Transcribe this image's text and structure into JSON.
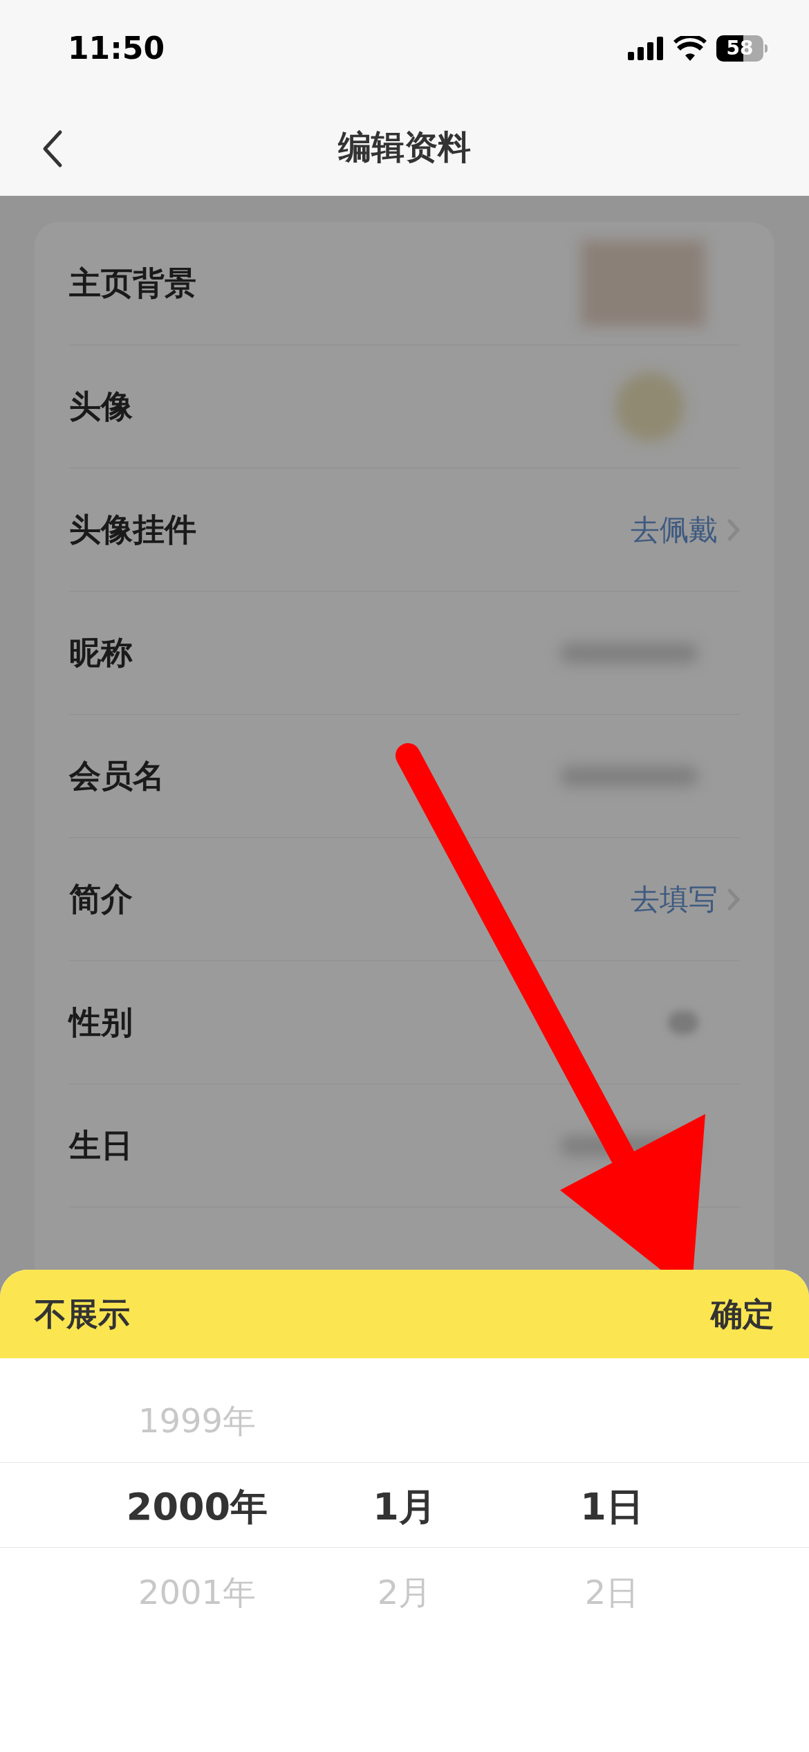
{
  "status_bar": {
    "time": "11:50",
    "battery": "58"
  },
  "nav": {
    "title": "编辑资料"
  },
  "rows": [
    {
      "label": "主页背景",
      "kind": "image"
    },
    {
      "label": "头像",
      "kind": "avatar"
    },
    {
      "label": "头像挂件",
      "kind": "link",
      "value": "去佩戴"
    },
    {
      "label": "昵称",
      "kind": "blurred"
    },
    {
      "label": "会员名",
      "kind": "blurred"
    },
    {
      "label": "简介",
      "kind": "link",
      "value": "去填写"
    },
    {
      "label": "性别",
      "kind": "dot"
    },
    {
      "label": "生日",
      "kind": "blurred"
    }
  ],
  "sheet": {
    "cancel": "不展示",
    "confirm": "确定",
    "columns": [
      {
        "items": [
          {
            "label": "1999年",
            "selected": false
          },
          {
            "label": "2000年",
            "selected": true
          },
          {
            "label": "2001年",
            "selected": false
          }
        ]
      },
      {
        "items": [
          {
            "label": "1月",
            "selected": true
          },
          {
            "label": "2月",
            "selected": false
          }
        ]
      },
      {
        "items": [
          {
            "label": "1日",
            "selected": true
          },
          {
            "label": "2日",
            "selected": false
          }
        ]
      }
    ]
  }
}
